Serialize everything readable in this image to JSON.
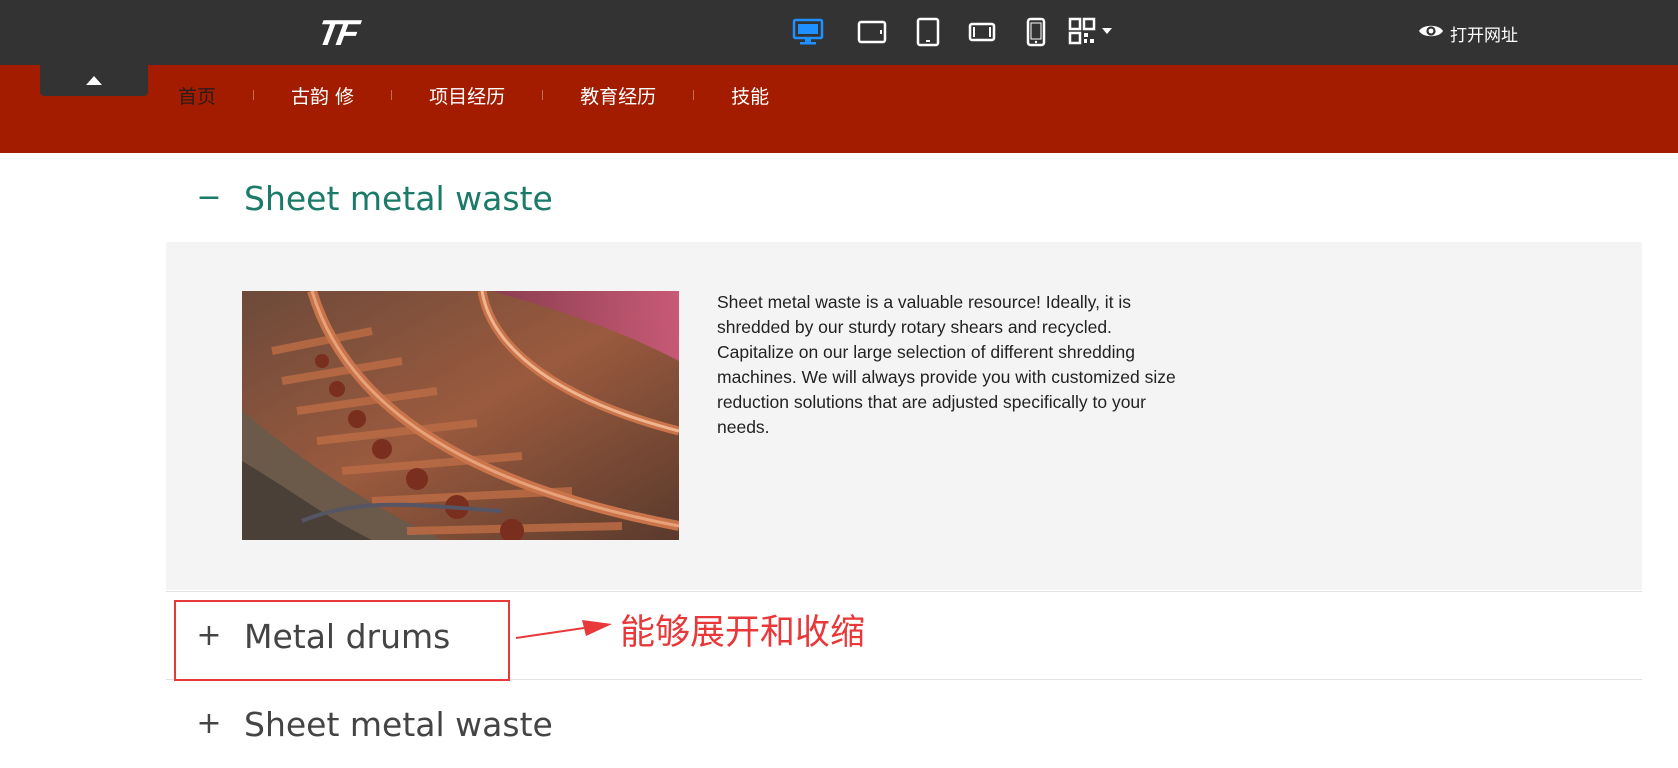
{
  "toolbar": {
    "logo": "TF",
    "devices": [
      {
        "icon": "desktop-icon",
        "active": true
      },
      {
        "icon": "tablet-landscape-icon",
        "active": false
      },
      {
        "icon": "tablet-portrait-icon",
        "active": false
      },
      {
        "icon": "phone-landscape-icon",
        "active": false
      },
      {
        "icon": "phone-portrait-icon",
        "active": false
      },
      {
        "icon": "qr-code-icon",
        "active": false
      }
    ],
    "open_url_label": "打开网址",
    "active_color": "#1e90ff"
  },
  "nav": {
    "items": [
      {
        "label": "首页",
        "active": true
      },
      {
        "label": "古韵 修",
        "active": false
      },
      {
        "label": "项目经历",
        "active": false
      },
      {
        "label": "教育经历",
        "active": false
      },
      {
        "label": "技能",
        "active": false
      }
    ]
  },
  "accordion": {
    "sections": [
      {
        "title": "Sheet metal waste",
        "sign": "−",
        "expanded": true,
        "image": "railway-track-photo",
        "text": "Sheet metal waste is a valuable resource! Ideally, it is shredded by our sturdy rotary shears and recycled. Capitalize on our large selection of different shredding machines. We will always provide you with customized size reduction solutions that are adjusted specifically to your needs."
      },
      {
        "title": "Metal drums",
        "sign": "+",
        "expanded": false
      },
      {
        "title": "Sheet metal waste",
        "sign": "+",
        "expanded": false
      }
    ]
  },
  "annotation": {
    "text": "能够展开和收缩",
    "color": "#e8383a"
  },
  "colors": {
    "topbar": "#333333",
    "navband": "#a31c00",
    "accent_open": "#1b7a68",
    "panel_bg": "#f4f4f4"
  }
}
